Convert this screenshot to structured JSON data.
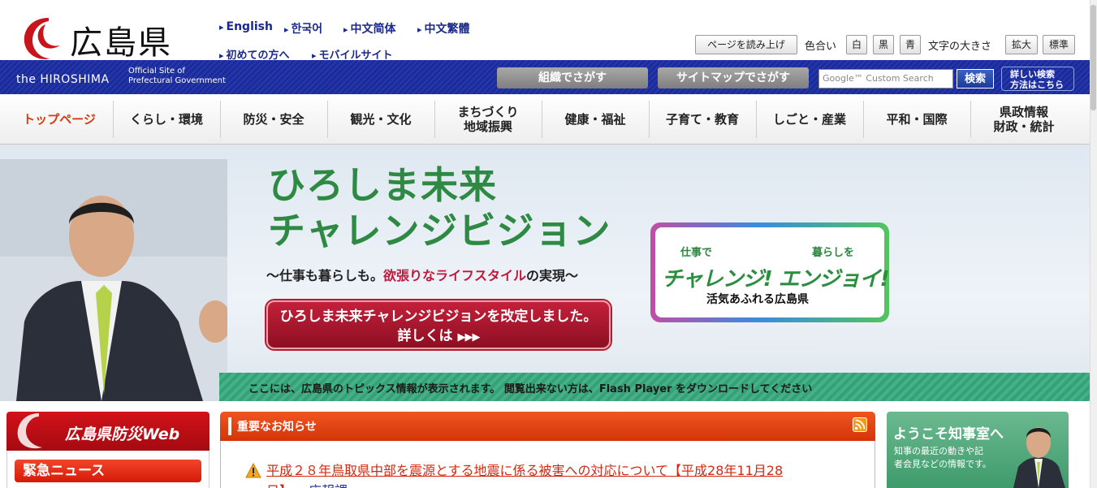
{
  "header": {
    "logo_text": "広島県",
    "languages": [
      "English",
      "한국어",
      "中文简体",
      "中文繁體"
    ],
    "sub_links": [
      "初めての方へ",
      "モバイルサイト"
    ],
    "tools": {
      "read_aloud": "ページを読み上げ",
      "color_label": "色合い",
      "color_white": "白",
      "color_black": "黒",
      "color_blue": "青",
      "text_size_label": "文字の大きさ",
      "enlarge": "拡大",
      "standard": "標準"
    }
  },
  "band": {
    "site_en": "the HIROSHIMA",
    "official_line1": "Official Site of",
    "official_line2": "Prefectural Government",
    "org_search": "組織でさがす",
    "sitemap_search": "サイトマップでさがす",
    "search_placeholder": "Google™ Custom Search",
    "search_button": "検索",
    "search_help_line1": "詳しい検索",
    "search_help_line2": "方法はこちら"
  },
  "nav": {
    "items": [
      {
        "label": "トップページ",
        "active": true
      },
      {
        "label": "くらし・環境"
      },
      {
        "label": "防災・安全"
      },
      {
        "label": "観光・文化"
      },
      {
        "label": "まちづくり\n地域振興"
      },
      {
        "label": "健康・福祉"
      },
      {
        "label": "子育て・教育"
      },
      {
        "label": "しごと・産業"
      },
      {
        "label": "平和・国際"
      },
      {
        "label": "県政情報\n財政・統計"
      }
    ]
  },
  "banner": {
    "title_line1": "ひろしま未来",
    "title_line2": "チャレンジビジョン",
    "subtitle_pre": "〜仕事も暮らしも。",
    "subtitle_hl": "欲張りなライフスタイル",
    "subtitle_post": "の実現〜",
    "cta_line1": "ひろしま未来チャレンジビジョンを改定しました。",
    "cta_line2": "詳しくは",
    "cta_arrows": "▶▶▶",
    "badge_top_left": "仕事で",
    "badge_top_right": "暮らしを",
    "badge_main": "チャレンジ! エンジョイ!",
    "badge_foot": "活気あふれる広島県",
    "ticker": "ここには、広島県のトピックス情報が表示されます。 閲覧出来ない方は、Flash Player をダウンロードしてください"
  },
  "bousai": {
    "title": "広島県防災Web",
    "emergency": "緊急ニュース"
  },
  "notices": {
    "title": "重要なお知らせ",
    "item_line1": "平成２８年鳥取県中部を震源とする地震に係る被害への対応について【平成28年11月28",
    "item_line2": "日】",
    "item_dept": "広報課"
  },
  "governor": {
    "title": "ようこそ知事室へ",
    "desc_line1": "知事の最近の動きや記",
    "desc_line2": "者会見などの情報です。"
  },
  "colors": {
    "band_blue": "#1c2a9c",
    "accent_red": "#d23b11",
    "vision_green": "#2e8a43",
    "ticker_green": "#35a07a"
  }
}
